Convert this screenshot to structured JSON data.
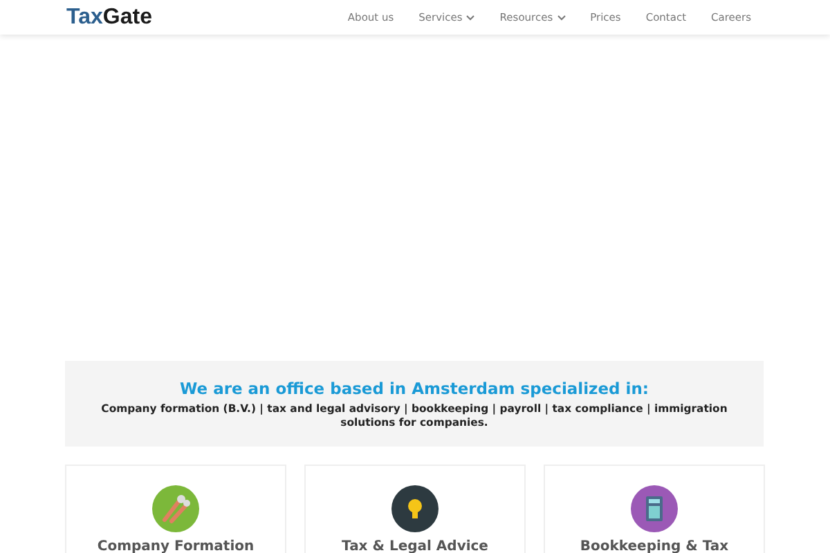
{
  "logo": {
    "first": "Tax",
    "second": "Gate"
  },
  "nav": [
    {
      "label": "About us",
      "dropdown": false
    },
    {
      "label": "Services",
      "dropdown": true
    },
    {
      "label": "Resources",
      "dropdown": true
    },
    {
      "label": "Prices",
      "dropdown": false
    },
    {
      "label": "Contact",
      "dropdown": false
    },
    {
      "label": "Careers",
      "dropdown": false
    }
  ],
  "intro": {
    "heading": "We are an office based in Amsterdam specialized in:",
    "text": "Company formation (B.V.) | tax and legal advisory | bookkeeping | payroll | tax compliance | immigration solutions for companies."
  },
  "services": [
    {
      "kind": "tools",
      "title": "Company Formation",
      "color": "#7cb83a"
    },
    {
      "kind": "bulb",
      "title": "Tax & Legal Advice",
      "color": "#2d3a40"
    },
    {
      "kind": "calculator",
      "title": "Bookkeeping & Tax",
      "color": "#9b59b6"
    }
  ]
}
